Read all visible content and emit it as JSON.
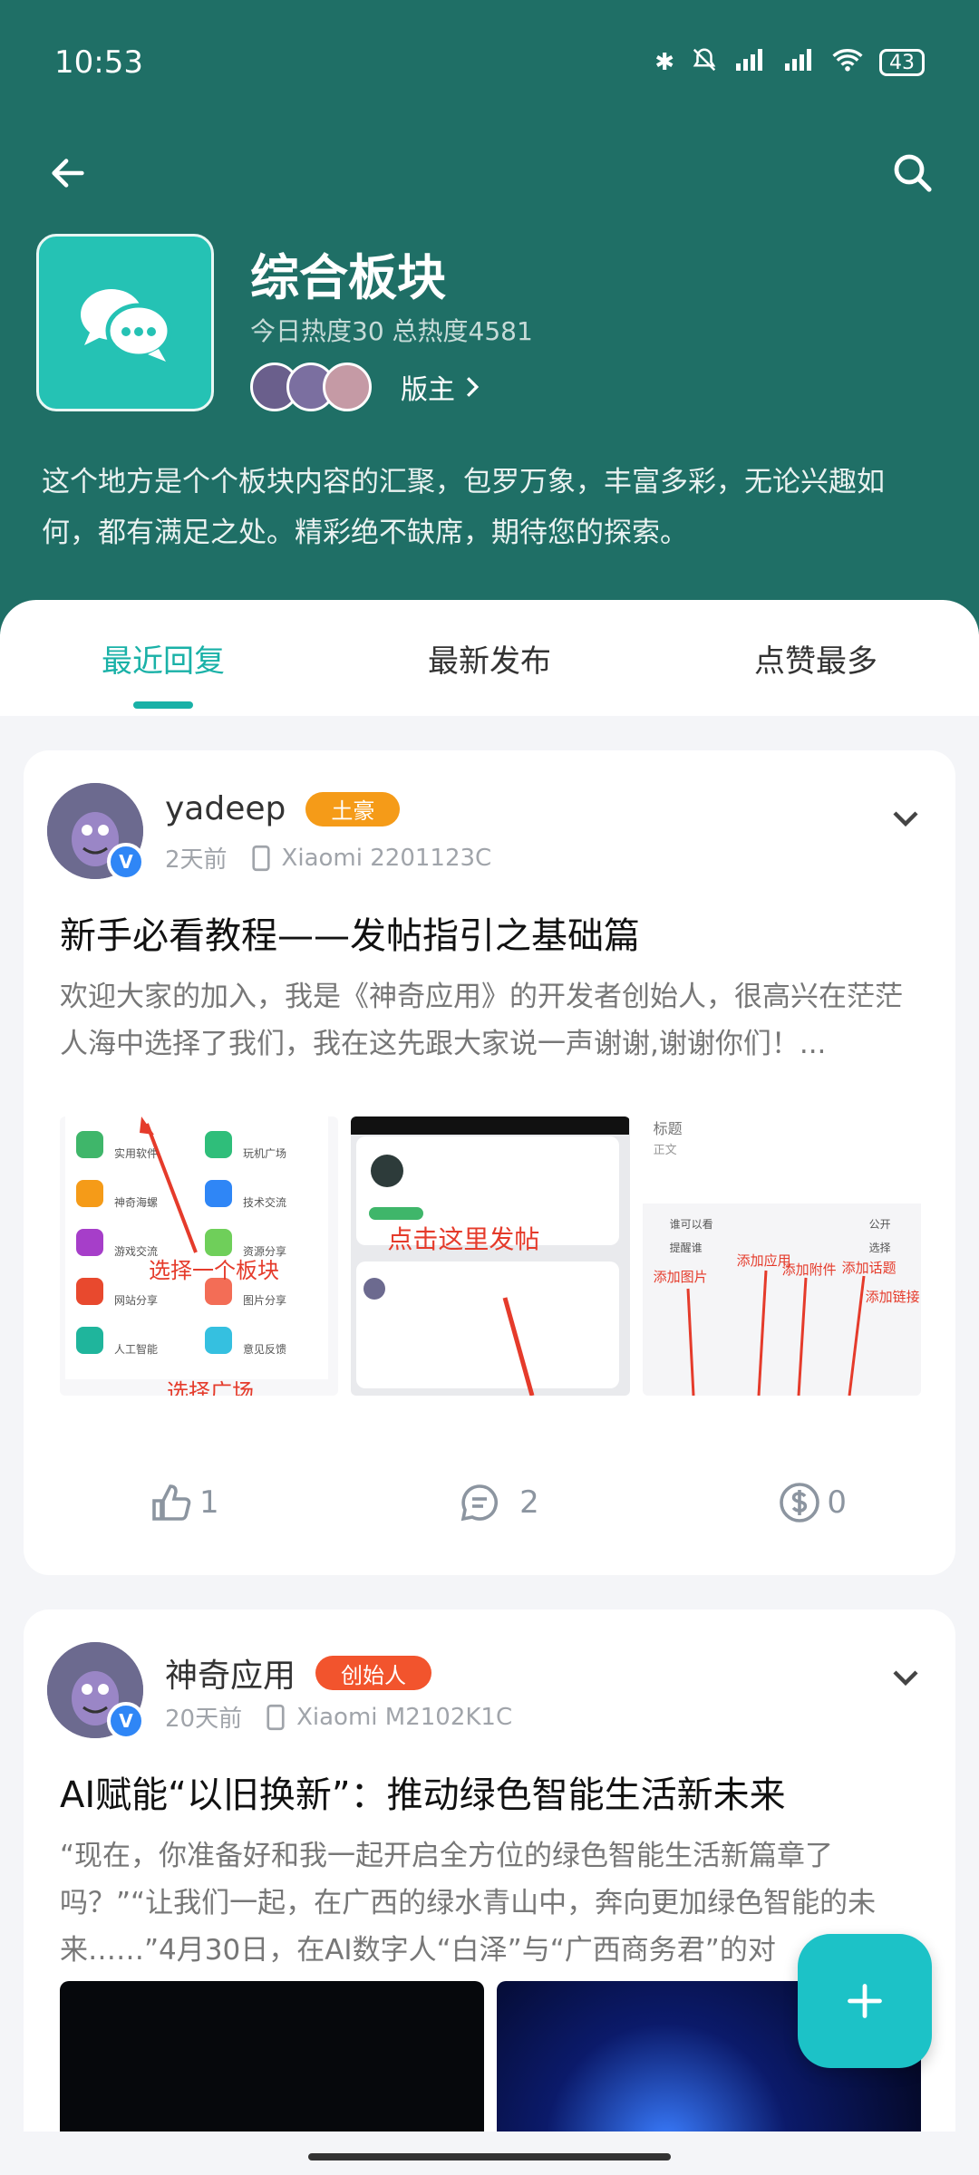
{
  "status_bar": {
    "time": "10:53",
    "battery": "43"
  },
  "header": {
    "board_title": "综合板块",
    "board_stats": "今日热度30 总热度4581",
    "moderator_label": "版主",
    "description": "这个地方是个个板块内容的汇聚，包罗万象，丰富多彩，无论兴趣如何，都有满足之处。精彩绝不缺席，期待您的探索。"
  },
  "tabs": [
    {
      "label": "最近回复",
      "active": true
    },
    {
      "label": "最新发布",
      "active": false
    },
    {
      "label": "点赞最多",
      "active": false
    }
  ],
  "posts": [
    {
      "username": "yadeep",
      "badge": "土豪",
      "time": "2天前",
      "device": "Xiaomi 2201123C",
      "title": "新手必看教程——发帖指引之基础篇",
      "excerpt": "欢迎大家的加入，我是《神奇应用》的开发者创始人，很高兴在茫茫人海中选择了我们，我在这先跟大家说一声谢谢,谢谢你们！...",
      "likes": "1",
      "comments": "2",
      "coins": "0",
      "image_annotations": {
        "select_board": "选择一个板块",
        "select_square": "选择广场",
        "click_post": "点击这里发帖",
        "title_label": "标题",
        "body_label": "正文",
        "who_can_see": "谁可以看",
        "public": "公开",
        "remind": "提醒谁",
        "choose": "选择",
        "add_app": "添加应用",
        "add_image": "添加图片",
        "add_attachment": "添加附件",
        "add_topic": "添加话题",
        "add_link": "添加链接"
      },
      "mini_apps": [
        "实用软件",
        "玩机广场",
        "神奇海螺",
        "技术交流",
        "游戏交流",
        "资源分享",
        "网站分享",
        "图片分享",
        "人工智能",
        "意见反馈"
      ]
    },
    {
      "username": "神奇应用",
      "badge": "创始人",
      "time": "20天前",
      "device": "Xiaomi M2102K1C",
      "title": "AI赋能“以旧换新”：推动绿色智能生活新未来",
      "excerpt": "“现在，你准备好和我一起开启全方位的绿色智能生活新篇章了吗？”“让我们一起，在广西的绿水青山中，奔向更加绿色智能的未来……”4月30日，在AI数字人“白泽”与“广西商务君”的对"
    }
  ],
  "colors": {
    "header_bg": "#1f6f66",
    "accent": "#19b1a7",
    "fab": "#1cc2c7",
    "badge_gold": "#f59b18",
    "badge_red": "#f2542d"
  }
}
